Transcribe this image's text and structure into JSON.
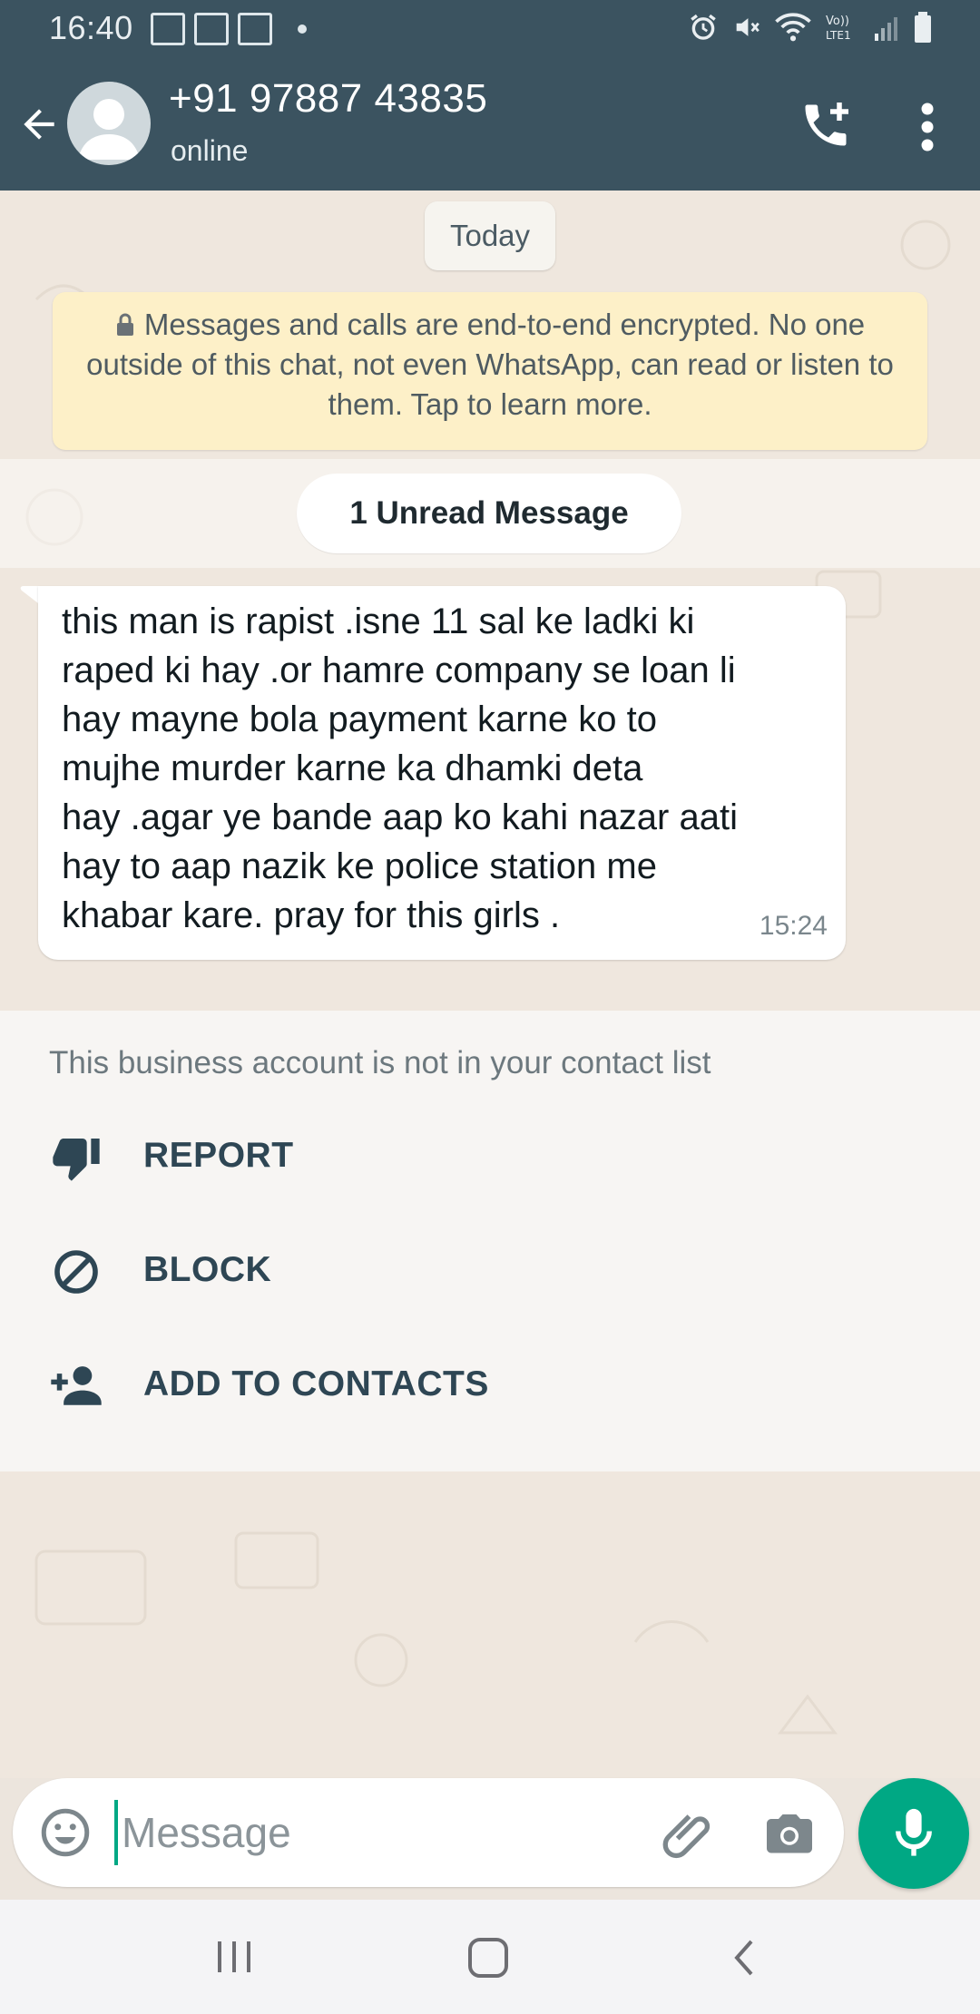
{
  "status_bar": {
    "time": "16:40"
  },
  "header": {
    "contact_name": "+91 97887 43835",
    "status": "online"
  },
  "chat": {
    "date_label": "Today",
    "encryption_notice": "Messages and calls are end-to-end encrypted. No one outside of this chat, not even WhatsApp, can read or listen to them. Tap to learn more.",
    "unread_label": "1 Unread Message",
    "messages": [
      {
        "lines": [
          "this man is rapist .isne 11 sal ke ladki ki",
          "raped ki hay .or hamre company se loan li",
          "hay mayne bola payment karne ko to",
          "mujhe murder karne ka dhamki deta",
          "hay .agar ye bande aap ko kahi nazar aati",
          "hay to aap nazik ke police station me",
          "khabar kare. pray for this girls ."
        ],
        "time": "15:24"
      }
    ]
  },
  "business_panel": {
    "note": "This business account is not in your contact list",
    "actions": [
      {
        "label": "REPORT",
        "icon": "thumb-down-icon"
      },
      {
        "label": "BLOCK",
        "icon": "block-icon"
      },
      {
        "label": "ADD TO CONTACTS",
        "icon": "add-person-icon"
      }
    ]
  },
  "composer": {
    "placeholder": "Message"
  },
  "colors": {
    "header_bg": "#3b5360",
    "accent": "#00a884",
    "chat_bg": "#efe7de",
    "notice_bg": "#fdf0c8"
  }
}
